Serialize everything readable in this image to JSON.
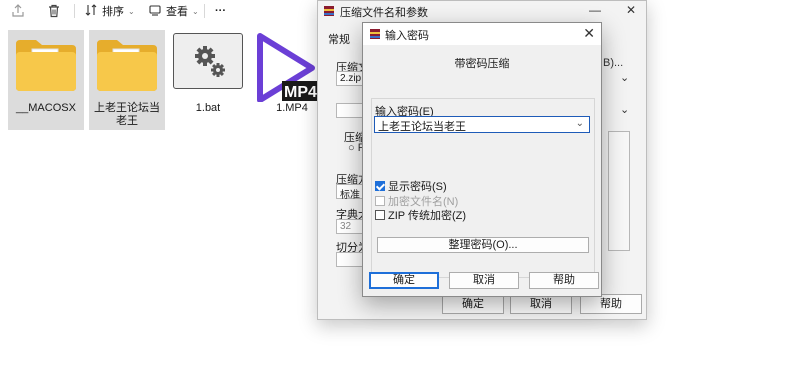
{
  "toolbar": {
    "sort_label": "排序",
    "view_label": "查看",
    "more_label": "···"
  },
  "files": [
    {
      "name": "__MACOSX",
      "kind": "folder"
    },
    {
      "name": "上老王论坛当老王",
      "kind": "folder"
    },
    {
      "name": "1.bat",
      "kind": "bat"
    },
    {
      "name": "1.MP4",
      "kind": "video",
      "badge": "MP4"
    }
  ],
  "archive_dialog": {
    "title": "压缩文件名和参数",
    "tab": "常规",
    "archive_label": "压缩文",
    "archive_name": "2.zip",
    "browse_fragment": "B)...",
    "format_label": "压缩",
    "format_radio": "R",
    "method_label": "压缩方",
    "method_value": "标准",
    "dict_label": "字典大",
    "dict_value": "32",
    "split_label": "切分为",
    "ok": "确定",
    "cancel": "取消",
    "help": "帮助"
  },
  "password_dialog": {
    "title": "输入密码",
    "subtitle": "带密码压缩",
    "enter_label": "输入密码(E)",
    "password_value": "上老王论坛当老王",
    "show_password": "显示密码(S)",
    "encrypt_names": "加密文件名(N)",
    "zip_legacy": "ZIP 传统加密(Z)",
    "organize": "整理密码(O)...",
    "ok": "确定",
    "cancel": "取消",
    "help": "帮助"
  },
  "colors": {
    "folder": "#f7c84a",
    "folder_dark": "#e6ad2c",
    "accent": "#1e6fd9",
    "mp4_purple": "#6b3fd6"
  }
}
